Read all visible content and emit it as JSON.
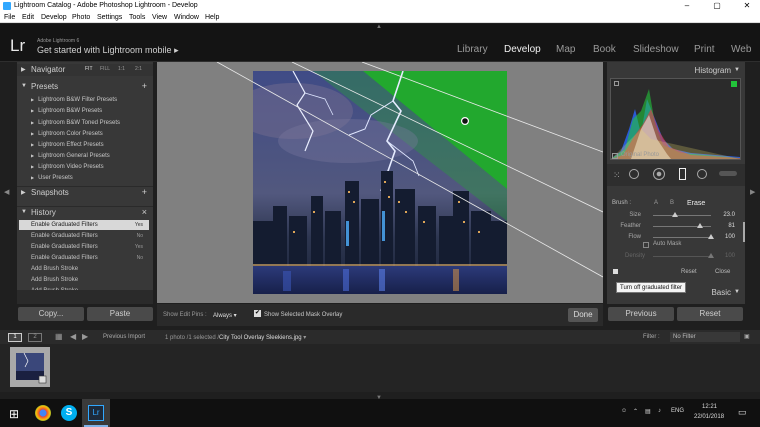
{
  "window": {
    "title": "Lightroom Catalog - Adobe Photoshop Lightroom - Develop",
    "minimize": "–",
    "maximize": "▢",
    "close": "✕"
  },
  "menu": [
    "File",
    "Edit",
    "Develop",
    "Photo",
    "Settings",
    "Tools",
    "View",
    "Window",
    "Help"
  ],
  "identity": {
    "logo": "Lr",
    "version": "Adobe Lightroom 6",
    "mobile_text": "Get started with Lightroom mobile",
    "mobile_arrow": "▸"
  },
  "modules": [
    "Library",
    "Develop",
    "Map",
    "Book",
    "Slideshow",
    "Print",
    "Web"
  ],
  "active_module": "Develop",
  "left_panel": {
    "navigator": {
      "label": "Navigator",
      "zoom": [
        "FIT",
        "FILL",
        "1:1",
        "2:1"
      ]
    },
    "presets": {
      "label": "Presets",
      "add": "+",
      "items": [
        "Lightroom B&W Filter Presets",
        "Lightroom B&W Presets",
        "Lightroom B&W Toned Presets",
        "Lightroom Color Presets",
        "Lightroom Effect Presets",
        "Lightroom General Presets",
        "Lightroom Video Presets",
        "User Presets"
      ]
    },
    "snapshots": {
      "label": "Snapshots",
      "add": "+"
    },
    "history": {
      "label": "History",
      "clear": "×",
      "items": [
        {
          "name": "Enable Graduated Filters",
          "value": "Yes",
          "selected": true
        },
        {
          "name": "Enable Graduated Filters",
          "value": "No",
          "selected": false
        },
        {
          "name": "Enable Graduated Filters",
          "value": "Yes",
          "selected": false
        },
        {
          "name": "Enable Graduated Filters",
          "value": "No",
          "selected": false
        },
        {
          "name": "Add Brush Stroke",
          "value": "",
          "selected": false
        },
        {
          "name": "Add Brush Stroke",
          "value": "",
          "selected": false
        },
        {
          "name": "Add Brush Stroke",
          "value": "",
          "selected": false
        },
        {
          "name": "Add Brush Stroke",
          "value": "",
          "selected": false
        }
      ]
    },
    "copy_button": "Copy...",
    "paste_button": "Paste"
  },
  "toolbar": {
    "edit_pins_label": "Show Edit Pins :",
    "edit_pins_value": "Always",
    "mask_overlay_label": "Show Selected Mask Overlay",
    "mask_overlay_checked": true,
    "done_button": "Done"
  },
  "right_panel": {
    "histogram": {
      "label": "Histogram"
    },
    "original_photo": "Original Photo",
    "brush": {
      "label": "Brush :",
      "modes": [
        "A",
        "B",
        "Erase"
      ],
      "active_mode": "Erase",
      "sliders": [
        {
          "name": "Size",
          "value": "23.0",
          "fraction": 0.38
        },
        {
          "name": "Feather",
          "value": "81",
          "fraction": 0.81
        },
        {
          "name": "Flow",
          "value": "100",
          "fraction": 1.0
        }
      ],
      "auto_mask": "Auto Mask",
      "density_label": "Density",
      "density_value": "100",
      "density_fraction": 1.0
    },
    "reset_link": "Reset",
    "close_link": "Close",
    "tooltip": "Turn off graduated filter",
    "basic_label": "Basic",
    "previous_button": "Previous",
    "reset_button": "Reset"
  },
  "filmstrip": {
    "views": [
      "1",
      "2"
    ],
    "source": "Previous Import",
    "info_prefix": "1 photo /1 selected /",
    "filename": "City Tool Overlay Sleekiens.jpg",
    "filter_label": "Filter :",
    "filter_value": "No Filter"
  },
  "taskbar": {
    "lang": "ENG",
    "time": "12:21",
    "date": "22/01/2018"
  },
  "colors": {
    "lightroom_blue": "#31a8ff",
    "mask_green": "#22a82e",
    "panel_bg": "#383838"
  }
}
